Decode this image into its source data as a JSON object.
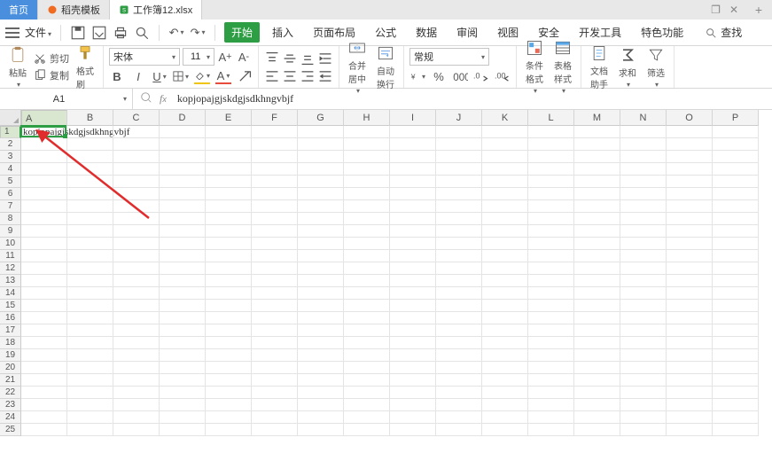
{
  "tabs": {
    "home": "首页",
    "docktpl": "稻壳模板",
    "workbook": "工作簿12.xlsx"
  },
  "menu": {
    "file": "文件",
    "start": "开始",
    "insert": "插入",
    "pagelayout": "页面布局",
    "formulas": "公式",
    "data": "数据",
    "review": "审阅",
    "view": "视图",
    "security": "安全",
    "devtools": "开发工具",
    "special": "特色功能",
    "search": "查找"
  },
  "ribbon": {
    "paste": "粘贴",
    "cut": "剪切",
    "copy": "复制",
    "fmtpaint": "格式刷",
    "font_name": "宋体",
    "font_size": "11",
    "merge": "合并居中",
    "wrap": "自动换行",
    "number_format": "常规",
    "condfmt": "条件格式",
    "tablestyle": "表格样式",
    "dochelper": "文档助手",
    "sum": "求和",
    "filter": "筛选"
  },
  "cellref": "A1",
  "formula_value": "kopjopajgjskdgjsdkhngvbjf",
  "columns": [
    "A",
    "B",
    "C",
    "D",
    "E",
    "F",
    "G",
    "H",
    "I",
    "J",
    "K",
    "L",
    "M",
    "N",
    "O",
    "P"
  ],
  "row_count": 25,
  "active_col_index": 0,
  "active_row_index": 0,
  "grid": {
    "A1": "kopjopajgjskdgjsdkhngvbjf"
  }
}
